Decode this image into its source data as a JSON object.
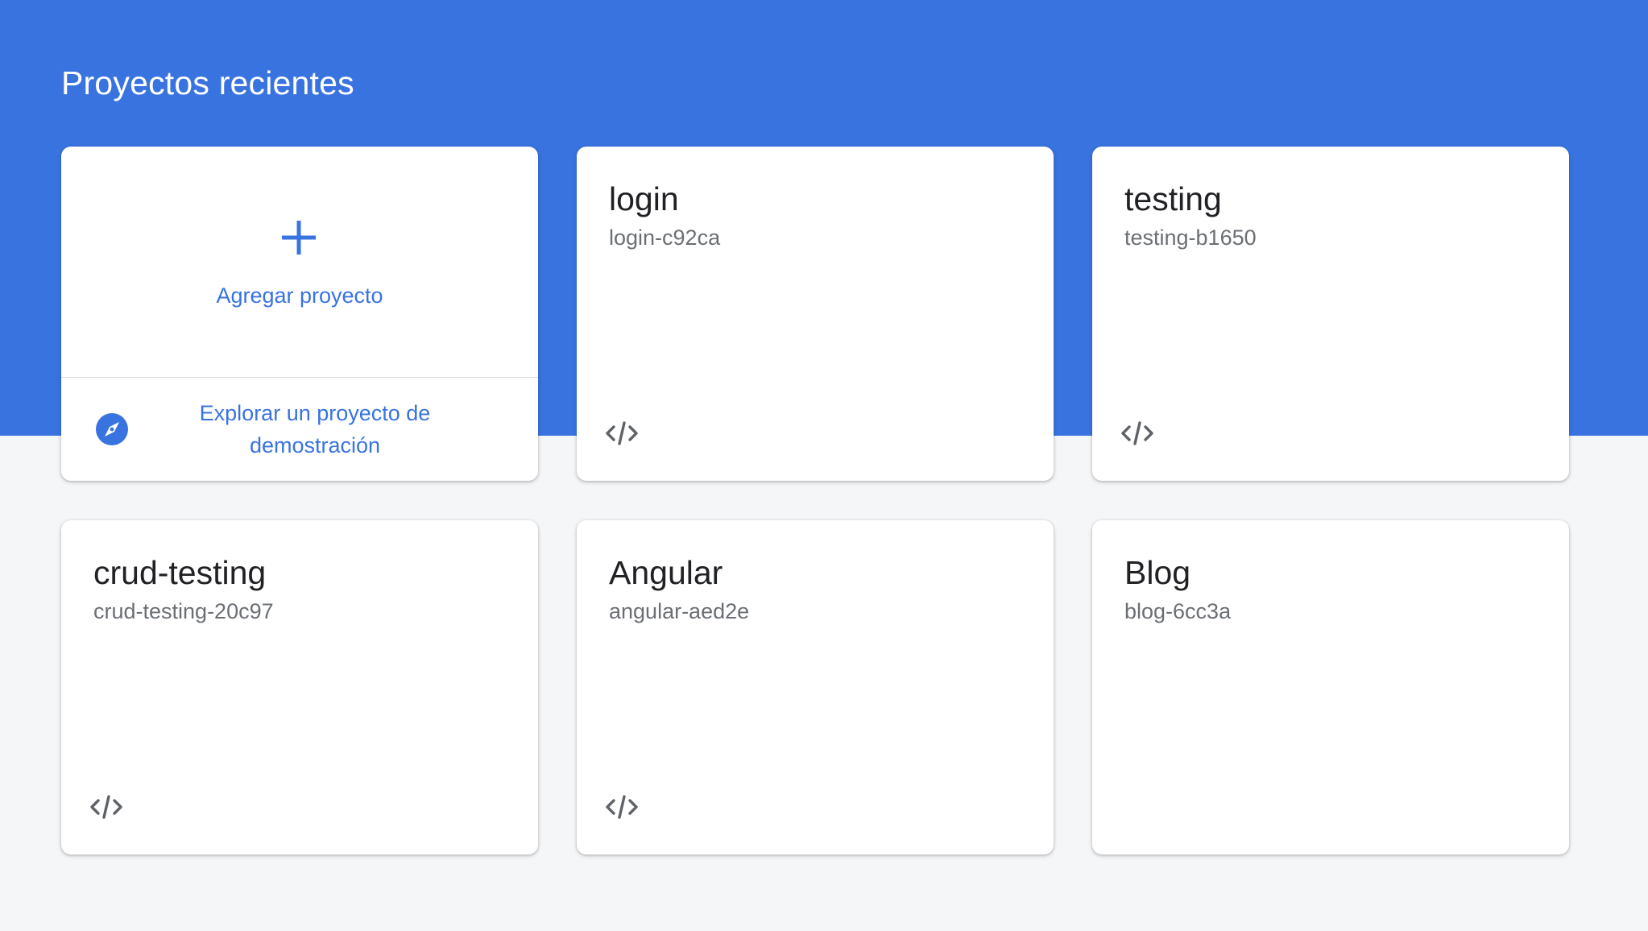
{
  "header": {
    "title": "Proyectos recientes"
  },
  "add_card": {
    "add_label": "Agregar proyecto",
    "add_icon": "plus-icon",
    "demo_label": "Explorar un proyecto de demostración",
    "demo_icon": "compass-icon"
  },
  "projects": [
    {
      "name": "login",
      "id": "login-c92ca",
      "has_web_app": true,
      "icon": "code-icon"
    },
    {
      "name": "testing",
      "id": "testing-b1650",
      "has_web_app": true,
      "icon": "code-icon"
    },
    {
      "name": "crud-testing",
      "id": "crud-testing-20c97",
      "has_web_app": true,
      "icon": "code-icon"
    },
    {
      "name": "Angular",
      "id": "angular-aed2e",
      "has_web_app": true,
      "icon": "code-icon"
    },
    {
      "name": "Blog",
      "id": "blog-6cc3a",
      "has_web_app": false
    }
  ],
  "colors": {
    "hero": "#3873e0",
    "accent": "#3873e0",
    "background": "#f5f6f8",
    "card": "#ffffff",
    "project_name": "#202124",
    "project_id": "#6b6f74",
    "icon": "#5f6368"
  }
}
